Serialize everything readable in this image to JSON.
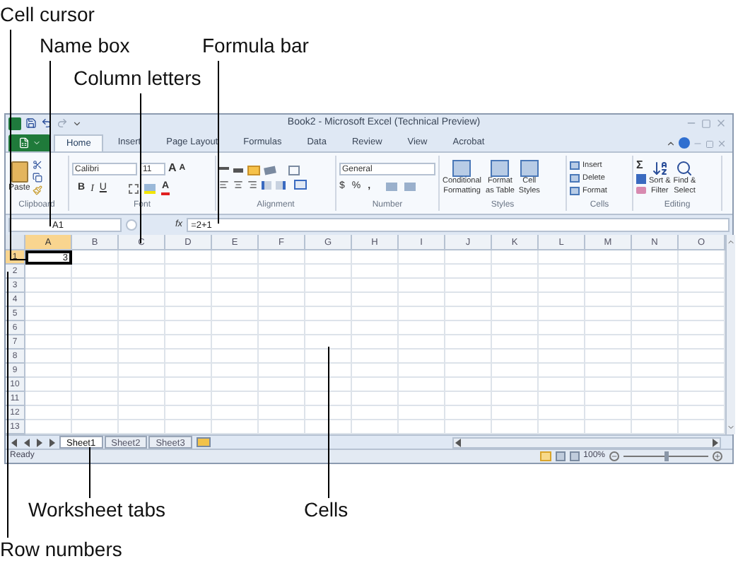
{
  "callouts": [
    {
      "text": "Cell cursor"
    },
    {
      "text": "Name box"
    },
    {
      "text": "Formula bar"
    },
    {
      "text": "Column letters"
    },
    {
      "text": "Worksheet tabs"
    },
    {
      "text": "Cells"
    },
    {
      "text": "Row numbers"
    }
  ],
  "window": {
    "title": "Book2 - Microsoft Excel (Technical Preview)"
  },
  "ribbon_tabs": [
    {
      "label": "Home",
      "selected": true
    },
    {
      "label": "Insert",
      "selected": false
    },
    {
      "label": "Page Layout",
      "selected": false
    },
    {
      "label": "Formulas",
      "selected": false
    },
    {
      "label": "Data",
      "selected": false
    },
    {
      "label": "Review",
      "selected": false
    },
    {
      "label": "View",
      "selected": false
    },
    {
      "label": "Acrobat",
      "selected": false
    }
  ],
  "ribbon": {
    "clipboard": {
      "label": "Clipboard",
      "paste": "Paste"
    },
    "font": {
      "label": "Font",
      "font_name": "Calibri",
      "font_size": "11",
      "grow": "A",
      "shrink": "A",
      "bold": "B",
      "italic": "I",
      "underline": "U",
      "font_color": "A"
    },
    "alignment": {
      "label": "Alignment"
    },
    "number": {
      "label": "Number",
      "format": "General",
      "currency": "$",
      "percent": "%",
      "comma": ","
    },
    "styles": {
      "label": "Styles",
      "buttons": [
        {
          "lines": [
            "Conditional",
            "Formatting"
          ]
        },
        {
          "lines": [
            "Format",
            "as Table"
          ]
        },
        {
          "lines": [
            "Cell",
            "Styles"
          ]
        }
      ]
    },
    "cells": {
      "label": "Cells",
      "buttons": [
        "Insert",
        "Delete",
        "Format"
      ]
    },
    "editing": {
      "label": "Editing",
      "sum": "Σ",
      "buttons": [
        {
          "lines": [
            "Sort &",
            "Filter"
          ]
        },
        {
          "lines": [
            "Find &",
            "Select"
          ]
        }
      ]
    }
  },
  "formula_bar": {
    "name_box": "A1",
    "fx": "fx",
    "formula": "=2+1"
  },
  "grid": {
    "columns": [
      {
        "label": "A",
        "selected": true
      },
      {
        "label": "B",
        "selected": false
      },
      {
        "label": "C",
        "selected": false
      },
      {
        "label": "D",
        "selected": false
      },
      {
        "label": "E",
        "selected": false
      },
      {
        "label": "F",
        "selected": false
      },
      {
        "label": "G",
        "selected": false
      },
      {
        "label": "H",
        "selected": false
      },
      {
        "label": "I",
        "selected": false
      },
      {
        "label": "J",
        "selected": false
      },
      {
        "label": "K",
        "selected": false
      },
      {
        "label": "L",
        "selected": false
      },
      {
        "label": "M",
        "selected": false
      },
      {
        "label": "N",
        "selected": false
      },
      {
        "label": "O",
        "selected": false
      }
    ],
    "rows": [
      {
        "label": "1",
        "selected": true
      },
      {
        "label": "2",
        "selected": false
      },
      {
        "label": "3",
        "selected": false
      },
      {
        "label": "4",
        "selected": false
      },
      {
        "label": "5",
        "selected": false
      },
      {
        "label": "6",
        "selected": false
      },
      {
        "label": "7",
        "selected": false
      },
      {
        "label": "8",
        "selected": false
      },
      {
        "label": "9",
        "selected": false
      },
      {
        "label": "10",
        "selected": false
      },
      {
        "label": "11",
        "selected": false
      },
      {
        "label": "12",
        "selected": false
      },
      {
        "label": "13",
        "selected": false
      }
    ],
    "active_value": "3"
  },
  "sheet_tabs": [
    {
      "label": "Sheet1",
      "selected": true
    },
    {
      "label": "Sheet2",
      "selected": false
    },
    {
      "label": "Sheet3",
      "selected": false
    }
  ],
  "status_bar": {
    "text": "Ready",
    "zoom": "100%",
    "zoom_slider": {
      "level": 0.5
    }
  }
}
